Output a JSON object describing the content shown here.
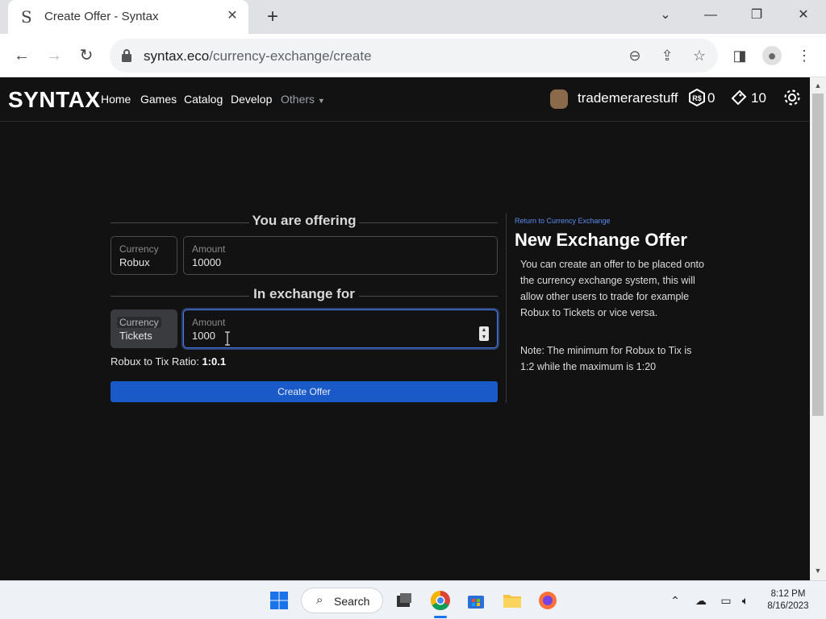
{
  "browser": {
    "tab_title": "Create Offer - Syntax",
    "url_domain": "syntax.eco",
    "url_path": "/currency-exchange/create"
  },
  "site": {
    "logo": "SYNTAX",
    "nav": [
      "Home",
      "Games",
      "Catalog",
      "Develop",
      "Others"
    ],
    "username": "trademerarestuff",
    "robux": "0",
    "tickets": "10"
  },
  "offering": {
    "title": "You are offering",
    "currency_label": "Currency",
    "currency_value": "Robux",
    "amount_label": "Amount",
    "amount_value": "10000"
  },
  "exchange": {
    "title": "In exchange for",
    "currency_label": "Currency",
    "currency_value": "Tickets",
    "amount_label": "Amount",
    "amount_value": "1000"
  },
  "ratio": {
    "label": "Robux to Tix Ratio:",
    "value": "1:0.1"
  },
  "create_button": "Create Offer",
  "sidebar": {
    "return_link": "Return to Currency Exchange",
    "title": "New Exchange Offer",
    "description": "You can create an offer to be placed onto the currency exchange system, this will allow other users to trade for example Robux to Tickets or vice versa.",
    "note": "Note: The minimum for Robux to Tix is 1:2 while the maximum is 1:20"
  },
  "taskbar": {
    "search_label": "Search",
    "time": "8:12 PM",
    "date": "8/16/2023"
  },
  "colors": {
    "accent": "#1a5ac8",
    "focus": "#4b7be5",
    "background": "#121213"
  }
}
